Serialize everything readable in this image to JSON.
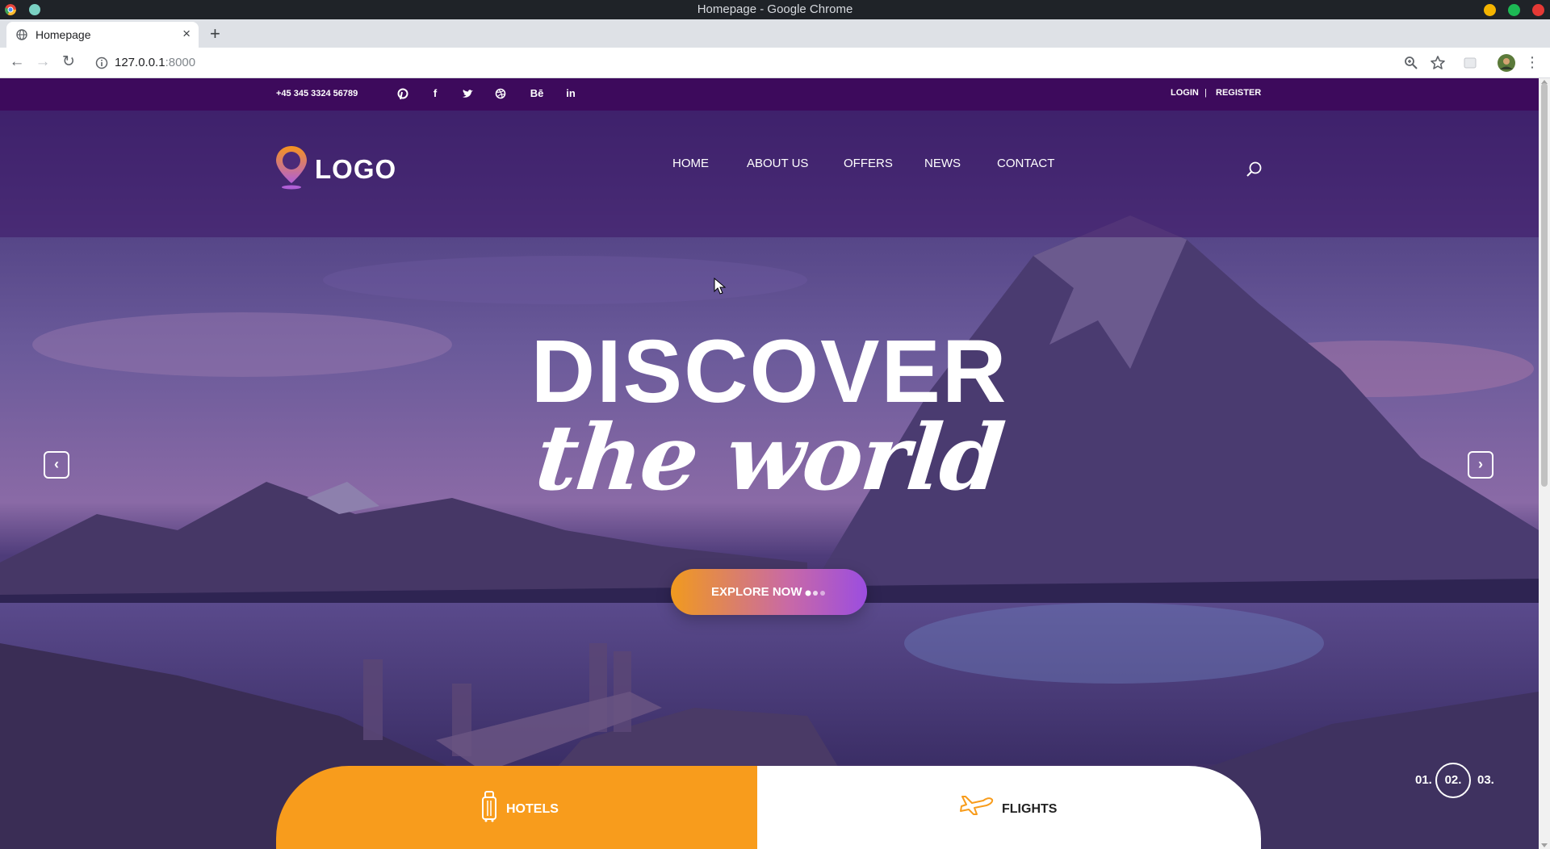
{
  "window": {
    "title": "Homepage - Google Chrome"
  },
  "browser": {
    "tab_title": "Homepage",
    "tab_close": "×",
    "new_tab": "+",
    "url_host": "127.0.0.1",
    "url_port": ":8000"
  },
  "topbar": {
    "phone": "+45 345 3324 56789",
    "social": [
      "pinterest-icon",
      "facebook-icon",
      "twitter-icon",
      "dribbble-icon",
      "behance-icon",
      "linkedin-icon"
    ],
    "social_glyphs": {
      "facebook": "f",
      "behance": "Bē",
      "linkedin": "in"
    },
    "login": "LOGIN",
    "separator": "|",
    "register": "REGISTER"
  },
  "header": {
    "logo": "LOGO",
    "nav": [
      "HOME",
      "ABOUT US",
      "OFFERS",
      "NEWS",
      "CONTACT"
    ]
  },
  "hero": {
    "headline": "DISCOVER",
    "subheadline": "the world",
    "cta": "EXPLORE NOW",
    "prev": "‹",
    "next": "›",
    "slides": [
      "01.",
      "02.",
      "03."
    ],
    "active_slide": 2
  },
  "booking": {
    "tabs": [
      "HOTELS",
      "FLIGHTS"
    ]
  },
  "colors": {
    "topbar_bg": "#3d0a5c",
    "accent_orange": "#f89c1c",
    "accent_purple": "#9b4de0"
  }
}
